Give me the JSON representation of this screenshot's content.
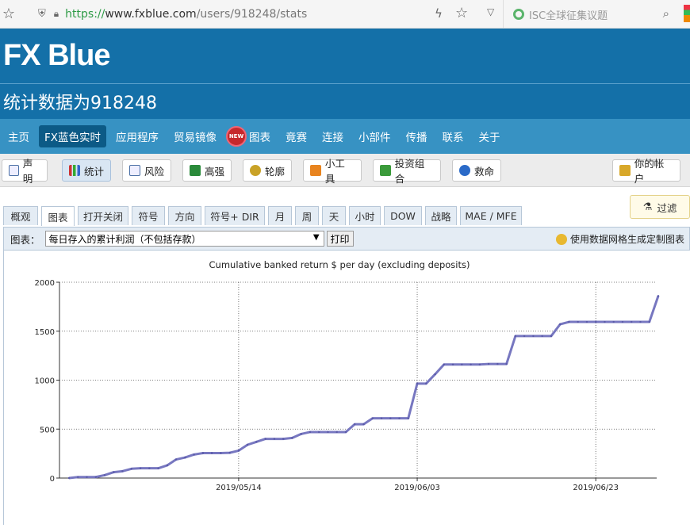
{
  "browser": {
    "url_scheme": "https://",
    "url_host": "www.fxblue.com",
    "url_path": "/users/918248/stats",
    "search_placeholder": "ISC全球征集议题"
  },
  "site": {
    "logo": "FX Blue",
    "page_title": "统计数据为918248"
  },
  "mainnav": {
    "items": [
      "主页",
      "FX蓝色实时",
      "应用程序",
      "贸易镜像",
      "图表",
      "竟赛",
      "连接",
      "小部件",
      "传播",
      "联系",
      "关于"
    ],
    "new_badge": "NEW"
  },
  "subnav": {
    "items": [
      "声明",
      "统计",
      "风险",
      "高强",
      "轮廓",
      "小工具",
      "投资组合",
      "救命"
    ],
    "account": "你的帐户"
  },
  "tabs": {
    "items": [
      "概观",
      "图表",
      "打开关闭",
      "符号",
      "方向",
      "符号+ DIR",
      "月",
      "周",
      "天",
      "小时",
      "DOW",
      "战略",
      "MAE / MFE"
    ],
    "filter": "过滤"
  },
  "selector": {
    "label": "图表：",
    "selected": "每日存入的累计利润（不包括存款）",
    "print": "打印",
    "custom_link": "使用数据网格生成定制图表"
  },
  "colors": {
    "header_blue": "#1470a8",
    "nav_blue": "#3792c3",
    "line": "#7777c0"
  },
  "chart_data": {
    "type": "line",
    "title": "Cumulative banked return $ per day (excluding deposits)",
    "ylim": [
      0,
      2000
    ],
    "yticks": [
      0,
      500,
      1000,
      1500,
      2000
    ],
    "xlim": [
      0,
      66
    ],
    "xticks": [
      {
        "x": 19,
        "label": "2019/05/14"
      },
      {
        "x": 39,
        "label": "2019/06/03"
      },
      {
        "x": 59,
        "label": "2019/06/23"
      }
    ],
    "grid": true,
    "series": [
      {
        "values": [
          [
            0,
            0
          ],
          [
            1,
            10
          ],
          [
            2,
            10
          ],
          [
            3,
            10
          ],
          [
            4,
            30
          ],
          [
            5,
            60
          ],
          [
            6,
            70
          ],
          [
            7,
            95
          ],
          [
            8,
            100
          ],
          [
            9,
            100
          ],
          [
            10,
            100
          ],
          [
            11,
            130
          ],
          [
            12,
            190
          ],
          [
            13,
            210
          ],
          [
            14,
            240
          ],
          [
            15,
            255
          ],
          [
            16,
            255
          ],
          [
            17,
            255
          ],
          [
            18,
            258
          ],
          [
            19,
            280
          ],
          [
            20,
            340
          ],
          [
            21,
            370
          ],
          [
            22,
            400
          ],
          [
            23,
            400
          ],
          [
            24,
            400
          ],
          [
            25,
            410
          ],
          [
            26,
            450
          ],
          [
            27,
            470
          ],
          [
            28,
            470
          ],
          [
            29,
            470
          ],
          [
            30,
            470
          ],
          [
            31,
            470
          ],
          [
            32,
            550
          ],
          [
            33,
            550
          ],
          [
            34,
            610
          ],
          [
            35,
            610
          ],
          [
            36,
            610
          ],
          [
            37,
            610
          ],
          [
            38,
            610
          ],
          [
            39,
            965
          ],
          [
            40,
            965
          ],
          [
            41,
            1060
          ],
          [
            42,
            1160
          ],
          [
            43,
            1160
          ],
          [
            44,
            1160
          ],
          [
            45,
            1160
          ],
          [
            46,
            1160
          ],
          [
            47,
            1165
          ],
          [
            48,
            1165
          ],
          [
            49,
            1165
          ],
          [
            50,
            1450
          ],
          [
            51,
            1450
          ],
          [
            52,
            1450
          ],
          [
            53,
            1450
          ],
          [
            54,
            1450
          ],
          [
            55,
            1570
          ],
          [
            56,
            1595
          ],
          [
            57,
            1595
          ],
          [
            58,
            1595
          ],
          [
            59,
            1595
          ],
          [
            60,
            1595
          ],
          [
            61,
            1595
          ],
          [
            62,
            1595
          ],
          [
            63,
            1595
          ],
          [
            64,
            1595
          ],
          [
            65,
            1595
          ],
          [
            66,
            1860
          ]
        ]
      }
    ]
  }
}
